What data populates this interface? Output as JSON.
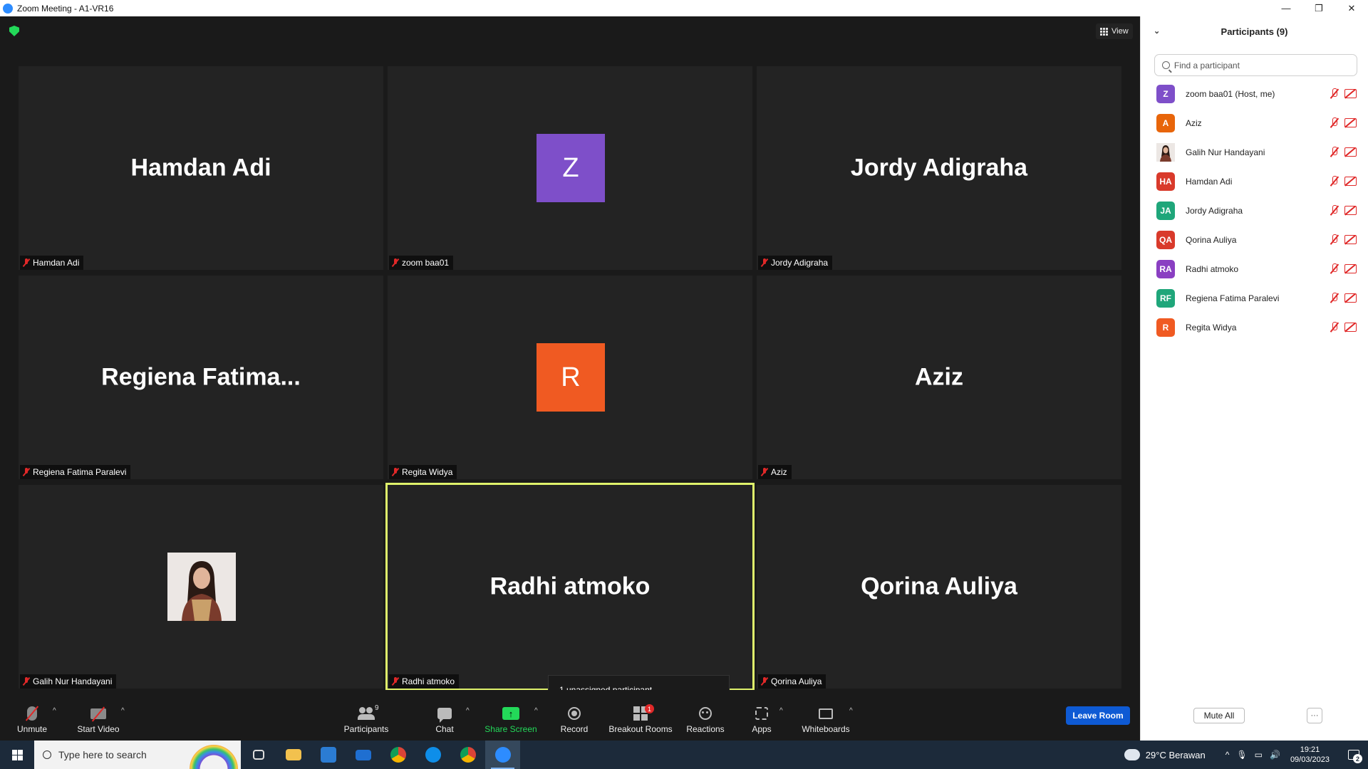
{
  "window": {
    "title": "Zoom Meeting - A1-VR16",
    "controls": {
      "minimize": "—",
      "restore": "❐",
      "close": "✕"
    }
  },
  "meeting": {
    "view_label": "View",
    "tiles": [
      {
        "big_name": "Hamdan Adi",
        "label": "Hamdan Adi"
      },
      {
        "avatar_letter": "Z",
        "avatar_color": "#7e4fc9",
        "label": "zoom baa01"
      },
      {
        "big_name": "Jordy Adigraha",
        "label": "Jordy Adigraha"
      },
      {
        "big_name": "Regiena  Fatima...",
        "label": "Regiena Fatima Paralevi"
      },
      {
        "avatar_letter": "R",
        "avatar_color": "#f05a22",
        "label": "Regita Widya"
      },
      {
        "big_name": "Aziz",
        "label": "Aziz"
      },
      {
        "photo": "profile-photo",
        "label": "Galih Nur Handayani"
      },
      {
        "big_name": "Radhi atmoko",
        "label": "Radhi atmoko",
        "active_speaker": true
      },
      {
        "big_name": "Qorina Auliya",
        "label": "Qorina Auliya"
      }
    ],
    "tooltip": "1 unassigned participant"
  },
  "toolbar": {
    "unmute": "Unmute",
    "start_video": "Start Video",
    "participants": "Participants",
    "participants_count": "9",
    "chat": "Chat",
    "share_screen": "Share Screen",
    "record": "Record",
    "breakout_rooms": "Breakout Rooms",
    "breakout_badge": "1",
    "reactions": "Reactions",
    "apps": "Apps",
    "whiteboards": "Whiteboards",
    "leave_room": "Leave Room",
    "caret": "^",
    "share_arrow": "↑"
  },
  "panel": {
    "title": "Participants (9)",
    "collapse_glyph": "⌄",
    "search_placeholder": "Find a participant",
    "participants": [
      {
        "initials": "Z",
        "color": "#7e4fc9",
        "name": "zoom baa01 (Host, me)"
      },
      {
        "initials": "A",
        "color": "#e8650a",
        "name": "Aziz"
      },
      {
        "initials": "",
        "color": "#e8e2df",
        "name": "Galih Nur Handayani",
        "photo": true
      },
      {
        "initials": "HA",
        "color": "#d93a2b",
        "name": "Hamdan Adi"
      },
      {
        "initials": "JA",
        "color": "#1fa67a",
        "name": "Jordy Adigraha"
      },
      {
        "initials": "QA",
        "color": "#d93a2b",
        "name": "Qorina Auliya"
      },
      {
        "initials": "RA",
        "color": "#8a3fc2",
        "name": "Radhi atmoko"
      },
      {
        "initials": "RF",
        "color": "#1fa67a",
        "name": "Regiena Fatima Paralevi"
      },
      {
        "initials": "R",
        "color": "#f05a22",
        "name": "Regita Widya"
      }
    ],
    "mute_all": "Mute All",
    "more": "···"
  },
  "taskbar": {
    "search_placeholder": "Type here to search",
    "weather": "29°C  Berawan",
    "time": "19:21",
    "date": "09/03/2023",
    "notifications": "2",
    "tray_icons": {
      "chevron": "^",
      "mic": "🎙",
      "network": "▭",
      "volume": "🔊"
    }
  }
}
